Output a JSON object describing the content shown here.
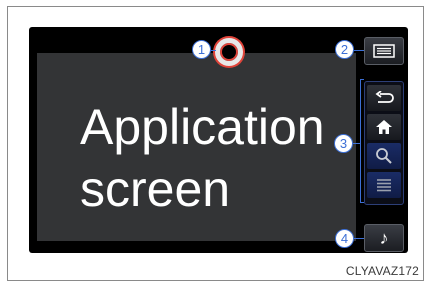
{
  "application_screen": {
    "line1": "Application",
    "line2": "screen"
  },
  "callouts": [
    "1",
    "2",
    "3",
    "4"
  ],
  "sidebar": {
    "menu_icon": "menu-icon",
    "group_icons": [
      "back-arrow-icon",
      "home-icon",
      "search-icon",
      "list-icon"
    ],
    "audio_icon": "music-note-icon"
  },
  "image_code": "CLYAVAZ172",
  "colors": {
    "callout_blue": "#3c6fd6",
    "indicator_red": "#e0443a",
    "screen_bg": "#333436"
  }
}
